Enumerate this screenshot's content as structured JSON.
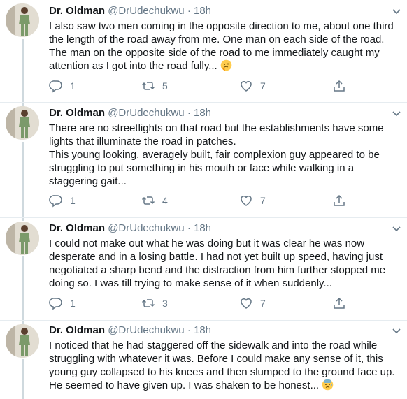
{
  "tweets": [
    {
      "name": "Dr. Oldman",
      "handle": "@DrUdechukwu",
      "time": "18h",
      "text": "I also saw two men coming in the opposite direction to me, about one third the length of the road away from me. One man on each side of the road. The man on the opposite side of the road to me immediately caught my attention as I got into the road fully...",
      "emoji": "thinking-face",
      "replies": "1",
      "retweets": "5",
      "likes": "7"
    },
    {
      "name": "Dr. Oldman",
      "handle": "@DrUdechukwu",
      "time": "18h",
      "text_lines": [
        "There are no streetlights on that road but the establishments have some lights that illuminate the road in patches.",
        "This young looking, averagely built, fair complexion guy appeared to be struggling to put something in his mouth or face while walking in a staggering gait..."
      ],
      "replies": "1",
      "retweets": "4",
      "likes": "7"
    },
    {
      "name": "Dr. Oldman",
      "handle": "@DrUdechukwu",
      "time": "18h",
      "text": "I could not make out what he was doing but it was clear he was now desperate and in a losing battle. I had not yet built up speed, having just negotiated a sharp bend and the distraction from him further stopped me doing so. I was till trying to make sense of it when suddenly...",
      "replies": "1",
      "retweets": "3",
      "likes": "7"
    },
    {
      "name": "Dr. Oldman",
      "handle": "@DrUdechukwu",
      "time": "18h",
      "text": "I noticed that he had staggered off the sidewalk and into the road while struggling with whatever it was. Before I could make any sense of it, this young guy collapsed to his knees and then slumped to the ground face up. He seemed to have given up. I was shaken to be honest...",
      "emoji": "anxious-face-with-sweat"
    }
  ],
  "separator": "·",
  "icons": {
    "reply": "reply-icon",
    "retweet": "retweet-icon",
    "like": "heart-icon",
    "share": "share-icon",
    "menu": "chevron-down-icon"
  },
  "colors": {
    "text": "#14171a",
    "secondary": "#657786",
    "divider": "#e6ecf0",
    "thread": "#cfd9de"
  }
}
